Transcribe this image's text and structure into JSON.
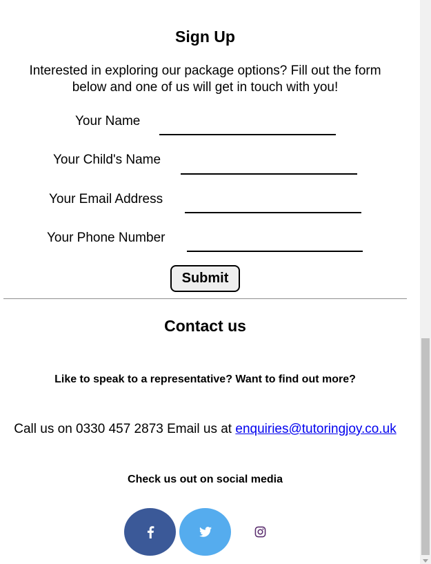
{
  "signup": {
    "title": "Sign Up",
    "intro": "Interested in exploring our package options? Fill out the form below and one of us will get in touch with you!",
    "fields": [
      {
        "label": "Your Name",
        "value": ""
      },
      {
        "label": "Your Child's Name",
        "value": ""
      },
      {
        "label": "Your Email Address",
        "value": ""
      },
      {
        "label": "Your Phone Number",
        "value": ""
      }
    ],
    "submit_label": "Submit"
  },
  "contact": {
    "title": "Contact us",
    "subheading": "Like to speak to a representative? Want to find out more?",
    "call_prefix": "Call us on 0330 457 2873 Email us at ",
    "email": "enquiries@tutoringjoy.co.uk",
    "social_heading": "Check us out on social media"
  },
  "social": {
    "facebook_icon": "facebook-icon",
    "twitter_icon": "twitter-icon",
    "instagram_icon": "instagram-icon",
    "facebook_color": "#3b5998",
    "twitter_color": "#55acee",
    "instagram_color": "#5a2d6e"
  }
}
